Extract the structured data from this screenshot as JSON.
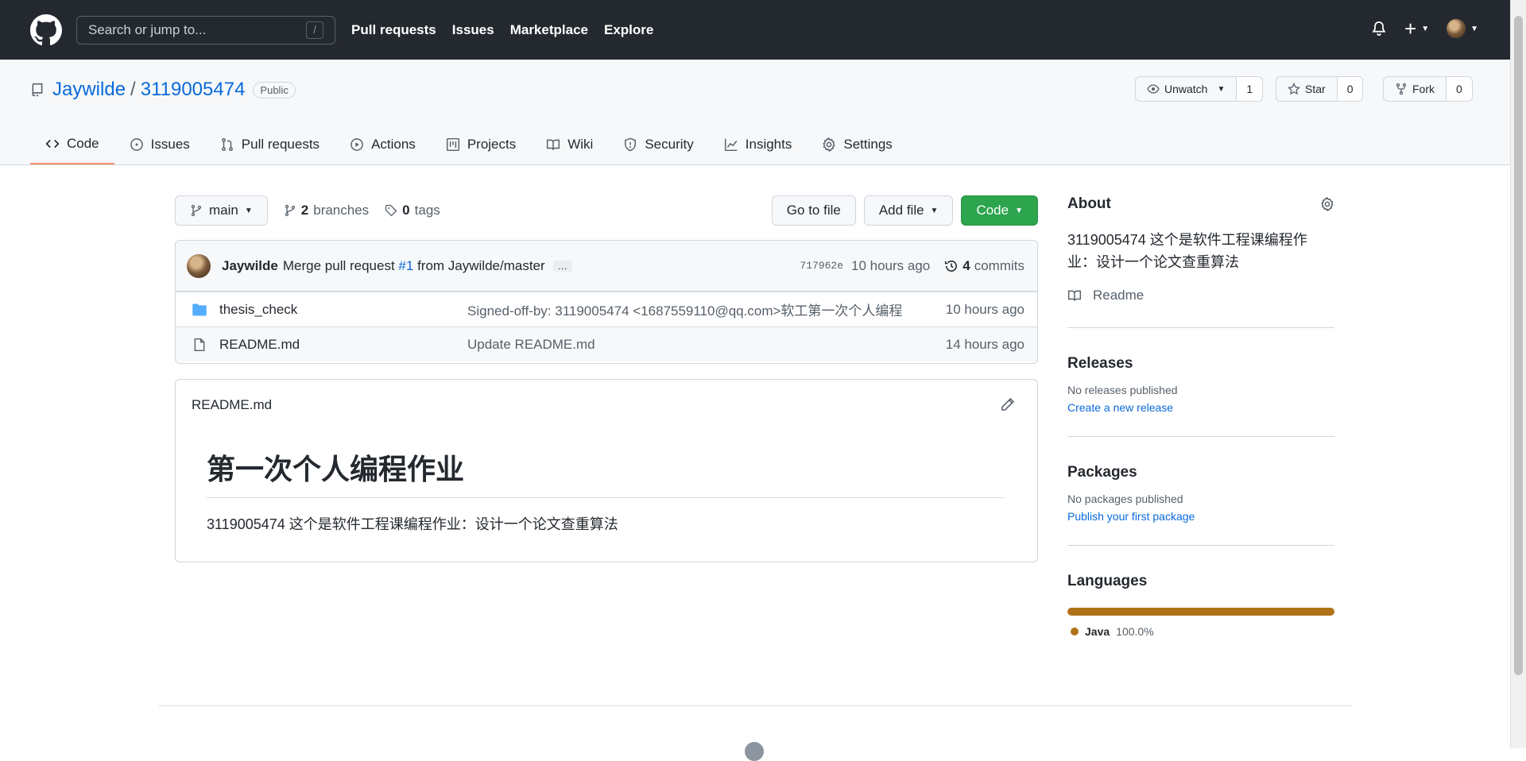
{
  "header": {
    "search_placeholder": "Search or jump to...",
    "search_shortcut": "/",
    "nav": [
      "Pull requests",
      "Issues",
      "Marketplace",
      "Explore"
    ],
    "plus_label": "+"
  },
  "repo": {
    "owner": "Jaywilde",
    "name": "3119005474",
    "visibility": "Public",
    "watch_label": "Unwatch",
    "watch_count": "1",
    "star_label": "Star",
    "star_count": "0",
    "fork_label": "Fork",
    "fork_count": "0"
  },
  "tabs": [
    {
      "label": "Code",
      "icon": "code-icon"
    },
    {
      "label": "Issues",
      "icon": "issue-icon"
    },
    {
      "label": "Pull requests",
      "icon": "pull-request-icon"
    },
    {
      "label": "Actions",
      "icon": "play-icon"
    },
    {
      "label": "Projects",
      "icon": "project-icon"
    },
    {
      "label": "Wiki",
      "icon": "book-icon"
    },
    {
      "label": "Security",
      "icon": "shield-icon"
    },
    {
      "label": "Insights",
      "icon": "graph-icon"
    },
    {
      "label": "Settings",
      "icon": "gear-icon"
    }
  ],
  "branchbar": {
    "branch": "main",
    "branch_count": "2",
    "branch_label": "branches",
    "tag_count": "0",
    "tag_label": "tags",
    "go_to_file": "Go to file",
    "add_file": "Add file",
    "code_button": "Code"
  },
  "commit": {
    "author": "Jaywilde",
    "message_prefix": "Merge pull request",
    "pr": "#1",
    "message_suffix": "from Jaywilde/master",
    "ellipsis": "…",
    "sha": "717962e",
    "time": "10 hours ago",
    "commit_count": "4",
    "commit_label": "commits"
  },
  "files": [
    {
      "name": "thesis_check",
      "type": "folder",
      "message": "Signed-off-by: 3119005474 <1687559110@qq.com>软工第一次个人编程",
      "time": "10 hours ago"
    },
    {
      "name": "README.md",
      "type": "file",
      "message": "Update README.md",
      "time": "14 hours ago"
    }
  ],
  "readme": {
    "filename": "README.md",
    "heading": "第一次个人编程作业",
    "body": "3119005474 这个是软件工程课编程作业：设计一个论文查重算法"
  },
  "sidebar": {
    "about_title": "About",
    "about_desc": "3119005474 这个是软件工程课编程作业：设计一个论文查重算法",
    "readme_link": "Readme",
    "releases_title": "Releases",
    "releases_muted": "No releases published",
    "releases_link": "Create a new release",
    "packages_title": "Packages",
    "packages_muted": "No packages published",
    "packages_link": "Publish your first package",
    "languages_title": "Languages",
    "languages": [
      {
        "name": "Java",
        "percent": "100.0%",
        "fraction": 1.0,
        "color": "#b07219"
      }
    ]
  },
  "colors": {
    "header_bg": "#24292f",
    "primary_green": "#2da44e",
    "link_blue": "#0969da",
    "tab_underline": "#fd8c73",
    "java": "#b07219"
  }
}
